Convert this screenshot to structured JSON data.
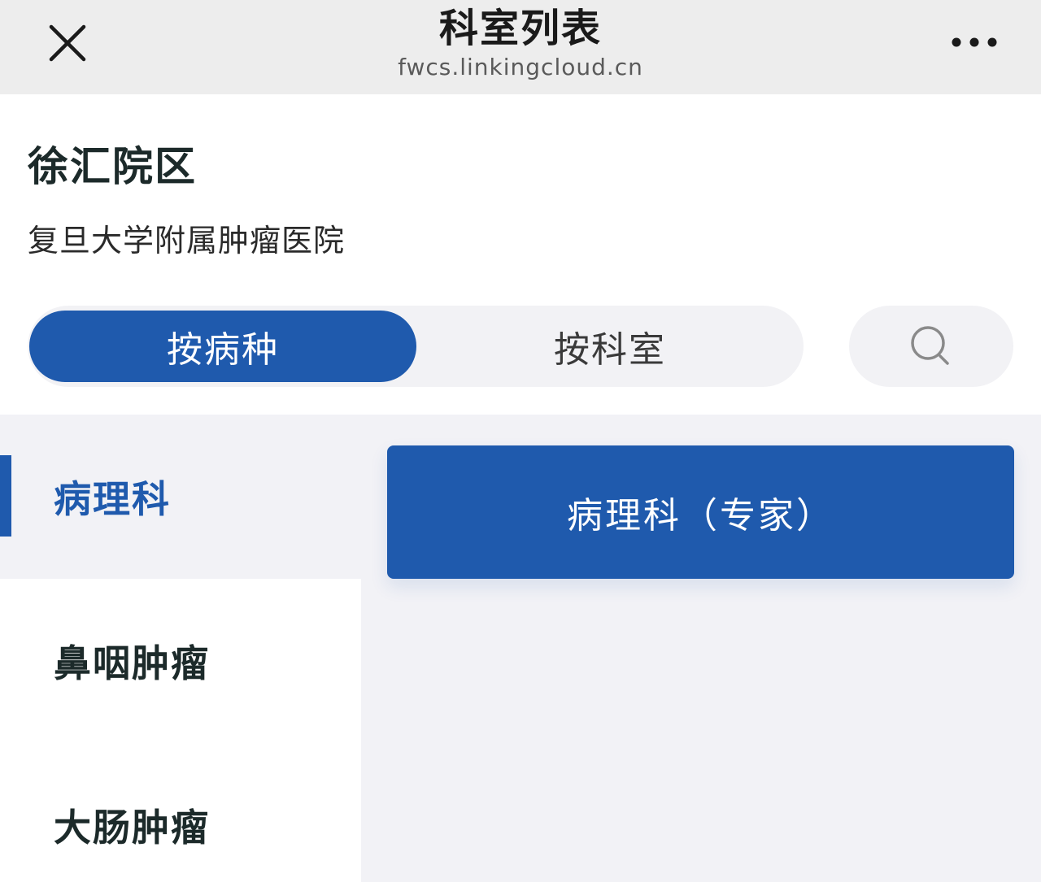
{
  "navbar": {
    "title": "科室列表",
    "url": "fwcs.linkingcloud.cn",
    "close_icon": "close-icon",
    "more_icon": "more-dots-icon"
  },
  "hospital": {
    "campus": "徐汇院区",
    "name": "复旦大学附属肿瘤医院"
  },
  "tabs": [
    {
      "label": "按病种",
      "active": true
    },
    {
      "label": "按科室",
      "active": false
    }
  ],
  "search": {
    "icon": "search-icon"
  },
  "left_list": [
    {
      "label": "病理科",
      "active": true
    },
    {
      "label": "鼻咽肿瘤",
      "active": false
    },
    {
      "label": "大肠肿瘤",
      "active": false
    }
  ],
  "departments": [
    {
      "label": "病理科（专家）"
    }
  ],
  "colors": {
    "accent": "#1f5aad",
    "navbar_bg": "#ededed",
    "panel_bg": "#f2f2f6"
  }
}
